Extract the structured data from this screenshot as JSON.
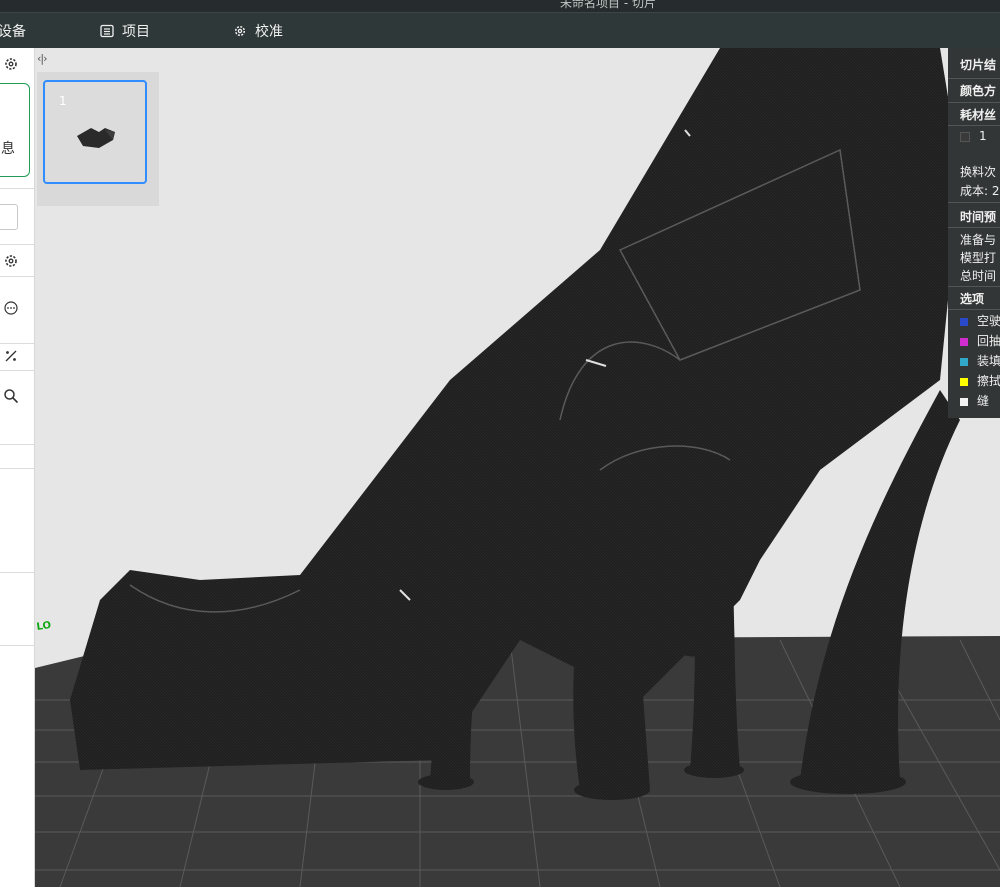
{
  "window": {
    "title": "未命名项目 - 切片"
  },
  "menu": {
    "device": "设备",
    "project": "项目",
    "calibrate": "校准"
  },
  "left_panel": {
    "card_text": "息"
  },
  "plates": [
    {
      "number": "1"
    }
  ],
  "right_panel": {
    "slice_result": "切片结",
    "color_scheme": "颜色方",
    "filament": "耗材丝",
    "filament_index": "1",
    "change_count": "换料次",
    "cost": "成本: 2",
    "time_estimate": "时间预",
    "prepare_time": "准备与",
    "model_print": "模型打",
    "total_time": "总时间",
    "options": "选项",
    "legend": [
      {
        "label": "空驶",
        "color": "#2a49c8"
      },
      {
        "label": "回抽",
        "color": "#d02cd0"
      },
      {
        "label": "装填",
        "color": "#32a8c8"
      },
      {
        "label": "擦拭",
        "color": "#ffff00"
      },
      {
        "label": "缝",
        "color": "#f2f2f2"
      }
    ]
  },
  "colors": {
    "toolbar_bg": "#2f3838",
    "accent_blue": "#2f8dff",
    "accent_green": "#1f9d55",
    "model": "#1f1f1f",
    "bed": "#3a3a3a"
  },
  "icons": [
    "gear-icon",
    "list-icon",
    "settings-icon",
    "more-icon",
    "percent-icon",
    "search-icon",
    "split-toggle-icon"
  ]
}
